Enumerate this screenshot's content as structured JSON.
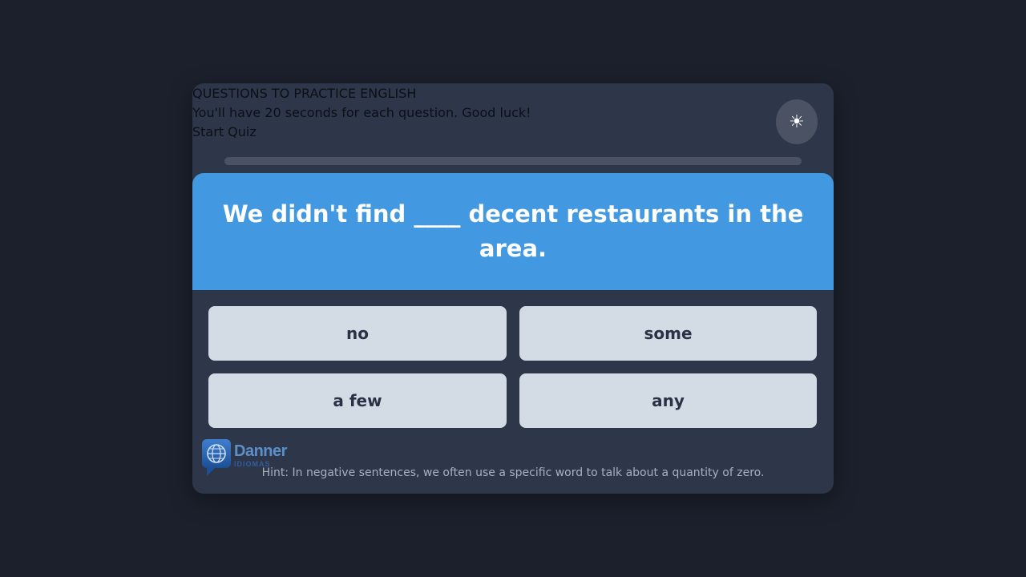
{
  "intro": {
    "title": "QUESTIONS TO PRACTICE ENGLISH",
    "instructions": "You'll have 20 seconds for each question. Good luck!",
    "start_label": "Start Quiz"
  },
  "theme_toggle": {
    "icon": "☀",
    "icon_name": "sun-icon"
  },
  "progress": {
    "fraction": 0
  },
  "question": {
    "text": "We didn't find ____ decent restaurants in the area."
  },
  "options": [
    {
      "label": "no"
    },
    {
      "label": "some"
    },
    {
      "label": "a few"
    },
    {
      "label": "any"
    }
  ],
  "logo": {
    "name": "Danner",
    "subtitle": "IDIOMAS"
  },
  "hint": {
    "text": "Hint: In negative sentences, we often use a specific word to talk about a quantity of zero."
  },
  "colors": {
    "page_background": "#1b202c",
    "card_background": "#2e3749",
    "accent": "#4299e1",
    "option_background": "#d3dce5",
    "option_text": "#2a3345"
  }
}
